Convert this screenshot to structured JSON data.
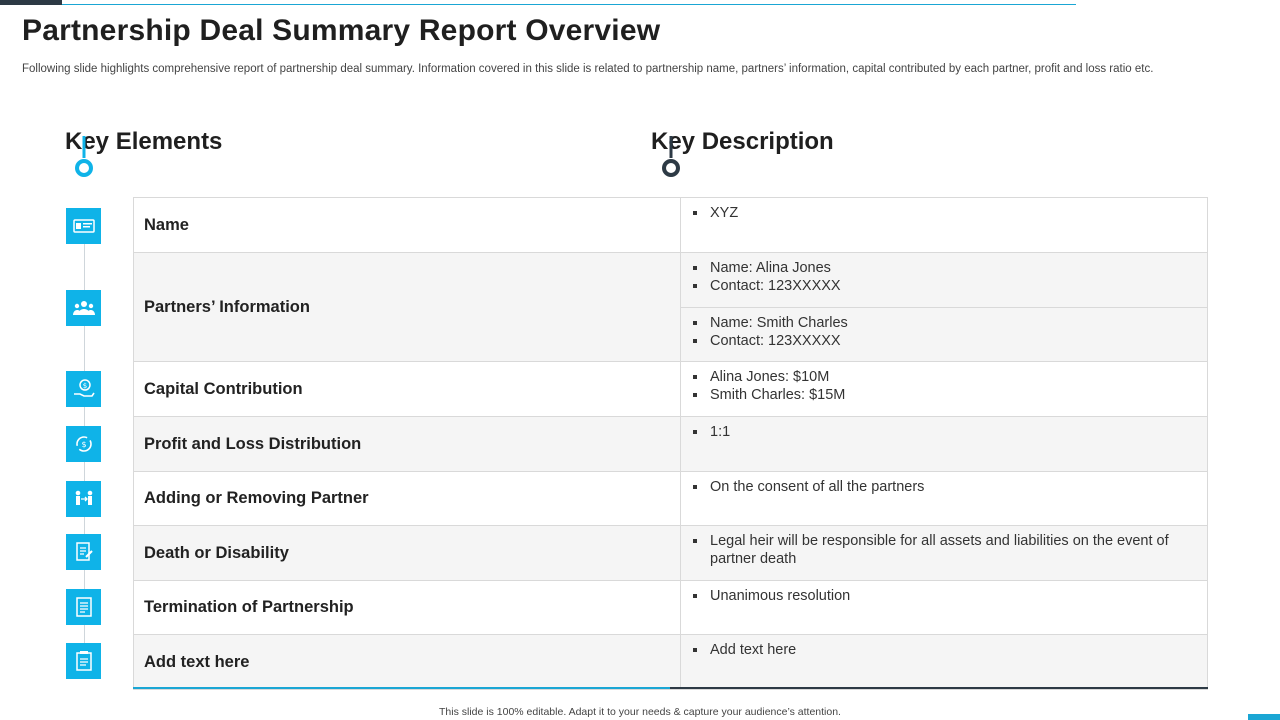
{
  "header": {
    "title": "Partnership Deal Summary Report Overview",
    "subtitle": "Following slide highlights comprehensive report of partnership deal summary. Information covered in this slide is related to partnership name, partners’ information, capital contributed by each partner, profit and loss ratio etc."
  },
  "columns": {
    "left_heading": "Key Elements",
    "right_heading": "Key Description"
  },
  "rows": [
    {
      "element": "Name",
      "icon": "id-card-icon",
      "description": [
        [
          "XYZ"
        ]
      ]
    },
    {
      "element": "Partners’ Information",
      "icon": "people-group-icon",
      "description": [
        [
          "Name: Alina Jones",
          "Contact: 123XXXXX"
        ],
        [
          "Name: Smith Charles",
          "Contact: 123XXXXX"
        ]
      ]
    },
    {
      "element": "Capital Contribution",
      "icon": "hand-money-icon",
      "description": [
        [
          "Alina Jones: $10M",
          "Smith Charles: $15M"
        ]
      ]
    },
    {
      "element": "Profit and Loss Distribution",
      "icon": "money-cycle-icon",
      "description": [
        [
          "1:1"
        ]
      ]
    },
    {
      "element": "Adding or Removing Partner",
      "icon": "people-exchange-icon",
      "description": [
        [
          "On the consent of all the partners"
        ]
      ]
    },
    {
      "element": "Death or Disability",
      "icon": "document-sign-icon",
      "description": [
        [
          "Legal heir will be responsible for all assets and liabilities on the event of partner death"
        ]
      ]
    },
    {
      "element": "Termination of Partnership",
      "icon": "document-icon",
      "description": [
        [
          "Unanimous resolution"
        ]
      ]
    },
    {
      "element": "Add text here",
      "icon": "notepad-icon",
      "description": [
        [
          "Add text here"
        ]
      ]
    }
  ],
  "footer": {
    "text": "This slide is 100% editable.  Adapt it to your needs & capture your audience’s attention."
  },
  "colors": {
    "accent": "#0fb3e8",
    "dark": "#2d3a45",
    "row_alt": "#f5f5f5"
  }
}
